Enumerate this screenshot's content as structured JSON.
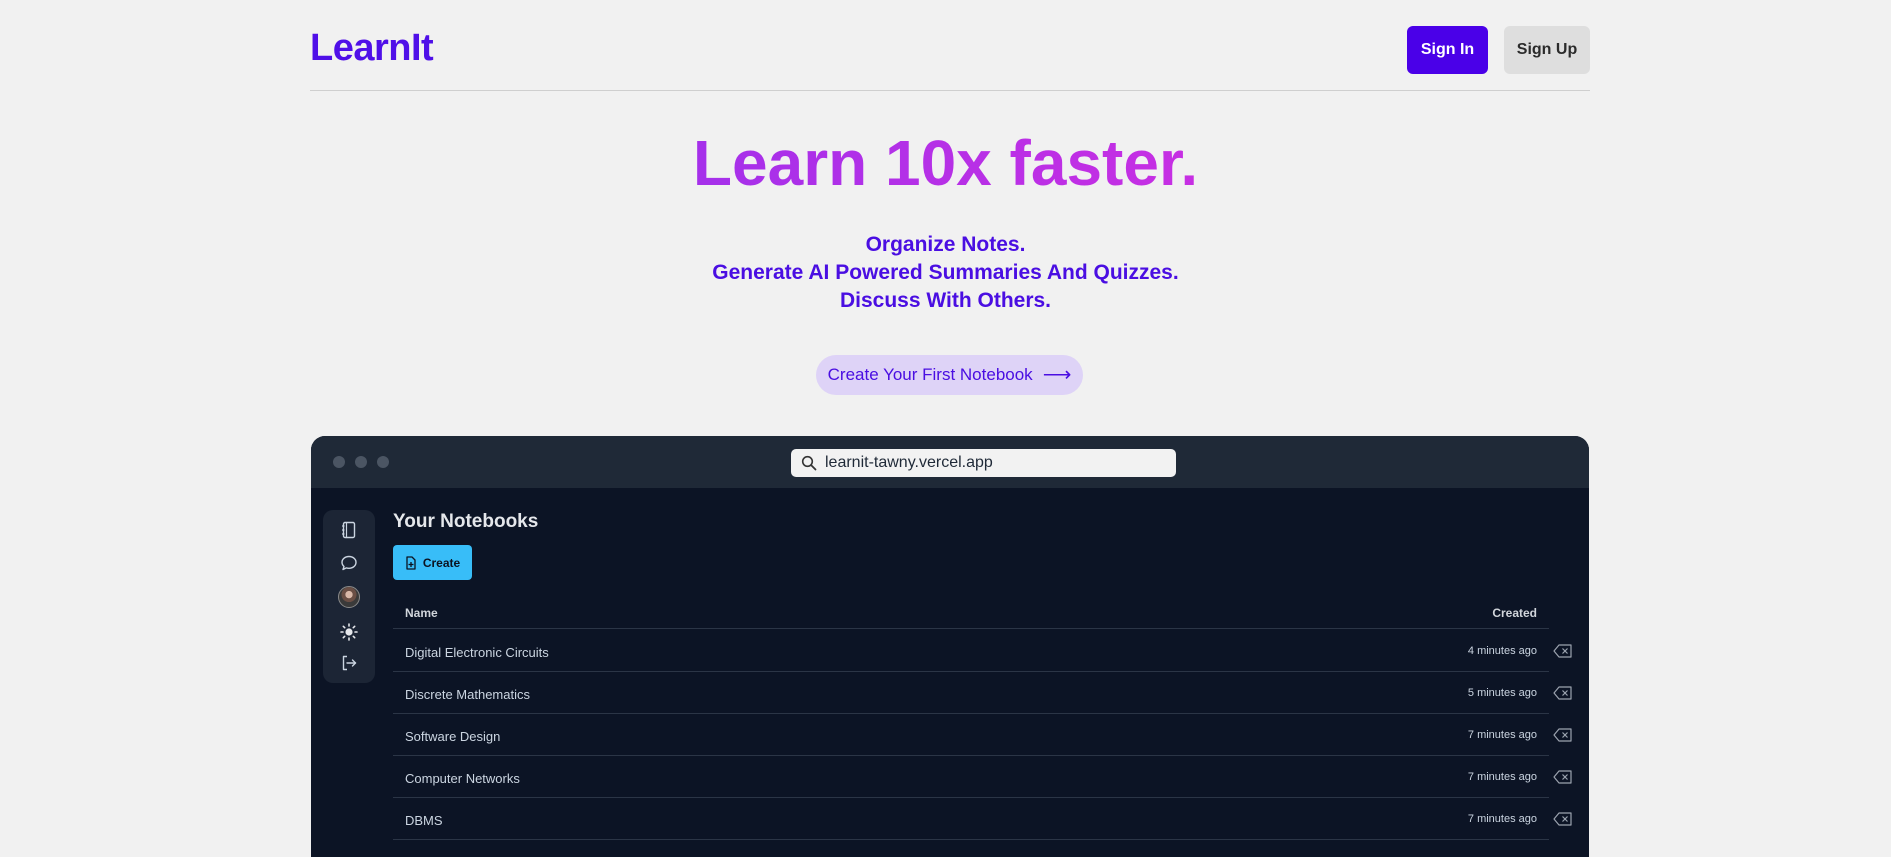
{
  "header": {
    "logo": "LearnIt",
    "sign_in": "Sign In",
    "sign_up": "Sign Up"
  },
  "hero": {
    "title": "Learn 10x faster.",
    "taglines": [
      "Organize Notes.",
      "Generate AI Powered Summaries And Quizzes.",
      "Discuss With Others."
    ],
    "cta_label": "Create Your First Notebook",
    "cta_arrow": "⟶"
  },
  "browser": {
    "url": "learnit-tawny.vercel.app",
    "sidebar_icons": [
      "notebook-icon",
      "chat-bubble-icon",
      "avatar",
      "sun-icon",
      "logout-icon"
    ],
    "page_title": "Your Notebooks",
    "create_label": "Create",
    "table": {
      "columns": [
        "Name",
        "Created"
      ],
      "rows": [
        {
          "name": "Digital Electronic Circuits",
          "created": "4 minutes ago"
        },
        {
          "name": "Discrete Mathematics",
          "created": "5 minutes ago"
        },
        {
          "name": "Software Design",
          "created": "7 minutes ago"
        },
        {
          "name": "Computer Networks",
          "created": "7 minutes ago"
        },
        {
          "name": "DBMS",
          "created": "7 minutes ago"
        }
      ]
    }
  },
  "colors": {
    "brand": "#4a00e8",
    "gradient_start": "#a530ea",
    "gradient_end": "#c72fe3",
    "create_button": "#38bdf8",
    "app_bg": "#0c1425"
  }
}
